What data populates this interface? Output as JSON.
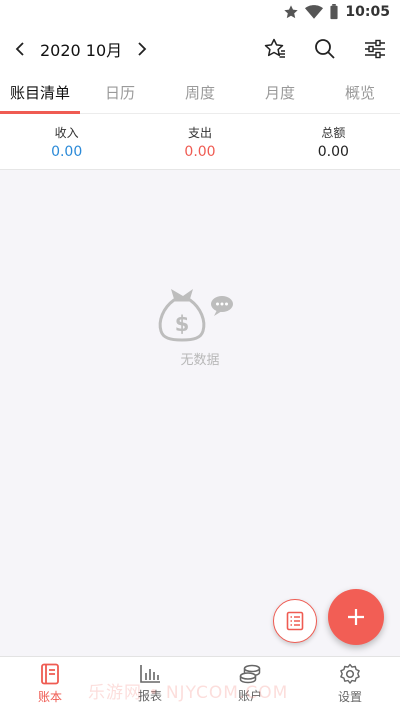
{
  "status_bar": {
    "time": "10:05",
    "icons": [
      "star-icon",
      "wifi-icon",
      "battery-icon"
    ]
  },
  "header": {
    "month": "2020 10月",
    "icons": [
      "chevron-left-icon",
      "chevron-right-icon",
      "star-list-icon",
      "search-icon",
      "filter-sliders-icon"
    ]
  },
  "tabs": [
    {
      "label": "账目清单",
      "active": true
    },
    {
      "label": "日历",
      "active": false
    },
    {
      "label": "周度",
      "active": false
    },
    {
      "label": "月度",
      "active": false
    },
    {
      "label": "概览",
      "active": false
    }
  ],
  "summary": {
    "income": {
      "label": "收入",
      "value": "0.00",
      "color": "#2b8ad8"
    },
    "expense": {
      "label": "支出",
      "value": "0.00",
      "color": "#ef5b52"
    },
    "total": {
      "label": "总额",
      "value": "0.00",
      "color": "#222222"
    }
  },
  "empty_state": {
    "text": "无数据",
    "icon": "money-bag-icon"
  },
  "fab": {
    "small_icon": "list-icon",
    "big_icon": "plus-icon"
  },
  "bottom_nav": [
    {
      "label": "账本",
      "icon": "book-icon",
      "active": true
    },
    {
      "label": "报表",
      "icon": "bar-chart-icon",
      "active": false
    },
    {
      "label": "账户",
      "icon": "coins-icon",
      "active": false
    },
    {
      "label": "设置",
      "icon": "gear-icon",
      "active": false
    }
  ],
  "watermark": "乐游网 • NJYCOM.COM",
  "colors": {
    "accent": "#ef5b52",
    "income": "#2b8ad8",
    "background": "#f6f5f9"
  }
}
